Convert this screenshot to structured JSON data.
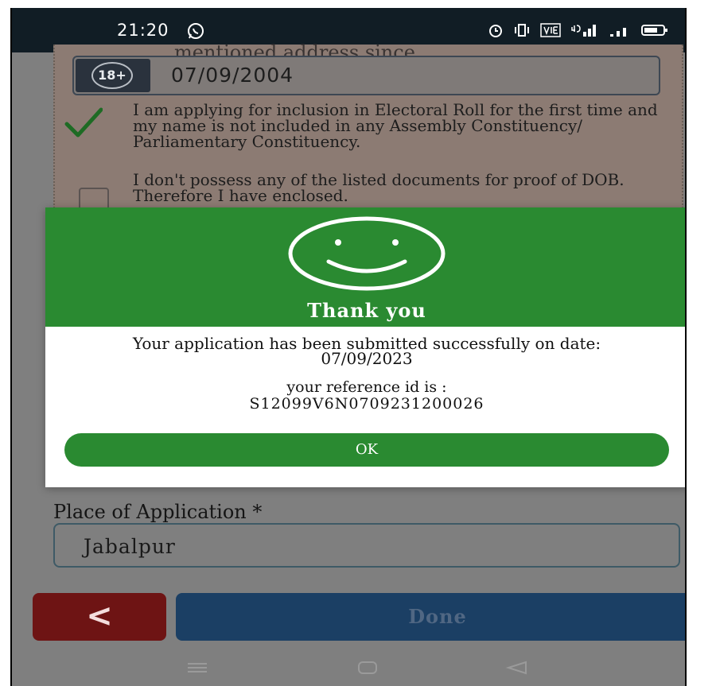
{
  "status_bar": {
    "time": "21:20"
  },
  "form": {
    "partial_text": "mentioned address since,",
    "age_badge": "18+",
    "dob_value": "07/09/2004",
    "first_time_text": "I am applying for inclusion in Electoral Roll for the first time and my name is not included in any Assembly Constituency/ Parliamentary Constituency.",
    "first_time_checked": true,
    "no_docs_text": "I don't possess any of the listed documents for proof of DOB. Therefore I have enclosed.",
    "no_docs_checked": false,
    "place_label": "Place of Application *",
    "place_value": "Jabalpur",
    "back_button_glyph": "<",
    "done_label": "Done"
  },
  "modal": {
    "title": "Thank you",
    "message": "Your application has been submitted successfully on date: 07/09/2023",
    "reference_label": "your reference id is :",
    "reference_id": "S12099V6N0709231200026",
    "ok_label": "OK"
  },
  "icons": {
    "status_right": [
      "alarm-icon",
      "vibrate-icon",
      "volte-icon",
      "signal-4g-icon",
      "signal-icon",
      "battery-icon"
    ],
    "smiley": "smiley-icon",
    "check": "checkmark-icon",
    "nav": [
      "menu-nav-icon",
      "home-nav-icon",
      "back-nav-icon"
    ]
  },
  "colors": {
    "header_green": "#2a8a31",
    "back_red": "#6e1414",
    "done_blue": "#1b3f64"
  }
}
